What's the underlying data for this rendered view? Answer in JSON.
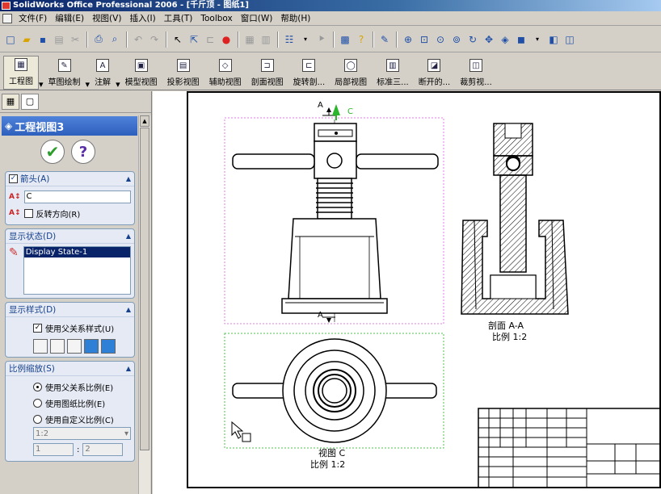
{
  "window": {
    "title": "SolidWorks Office Professional 2006 - [千斤顶 - 图纸1]"
  },
  "menu": [
    "文件(F)",
    "编辑(E)",
    "视图(V)",
    "插入(I)",
    "工具(T)",
    "Toolbox",
    "窗口(W)",
    "帮助(H)"
  ],
  "drawing_toolbar": {
    "items": [
      "工程图",
      "草图绘制",
      "注解",
      "模型视图",
      "投影视图",
      "辅助视图",
      "剖面视图",
      "旋转剖...",
      "局部视图",
      "标准三...",
      "断开的...",
      "裁剪视..."
    ]
  },
  "panel": {
    "title": "工程视图3",
    "arrow_group": {
      "title": "箭头(A)",
      "label_value": "C",
      "reverse_label": "反转方向(R)"
    },
    "display_state_group": {
      "title": "显示状态(D)",
      "selected_state": "Display State-1"
    },
    "display_style_group": {
      "title": "显示样式(D)",
      "use_parent_label": "使用父关系样式(U)"
    },
    "scale_group": {
      "title": "比例缩放(S)",
      "options": [
        "使用父关系比例(E)",
        "使用图纸比例(E)",
        "使用自定义比例(C)"
      ],
      "selected_option": 0,
      "custom_scale_value": "1:2",
      "ratio_left": "1",
      "ratio_sep": ":",
      "ratio_right": "2"
    }
  },
  "drawing": {
    "section_label_a": "A",
    "view_c_arrow_label": "C",
    "section_caption_1": "剖面 A-A",
    "section_caption_2": "比例 1:2",
    "view_c_caption_1": "视图 C",
    "view_c_caption_2": "比例 1:2"
  },
  "colors": {
    "accent": "#2d5fbd",
    "selection_border": "#e37ee3",
    "view_border_green": "#4fc04f"
  }
}
